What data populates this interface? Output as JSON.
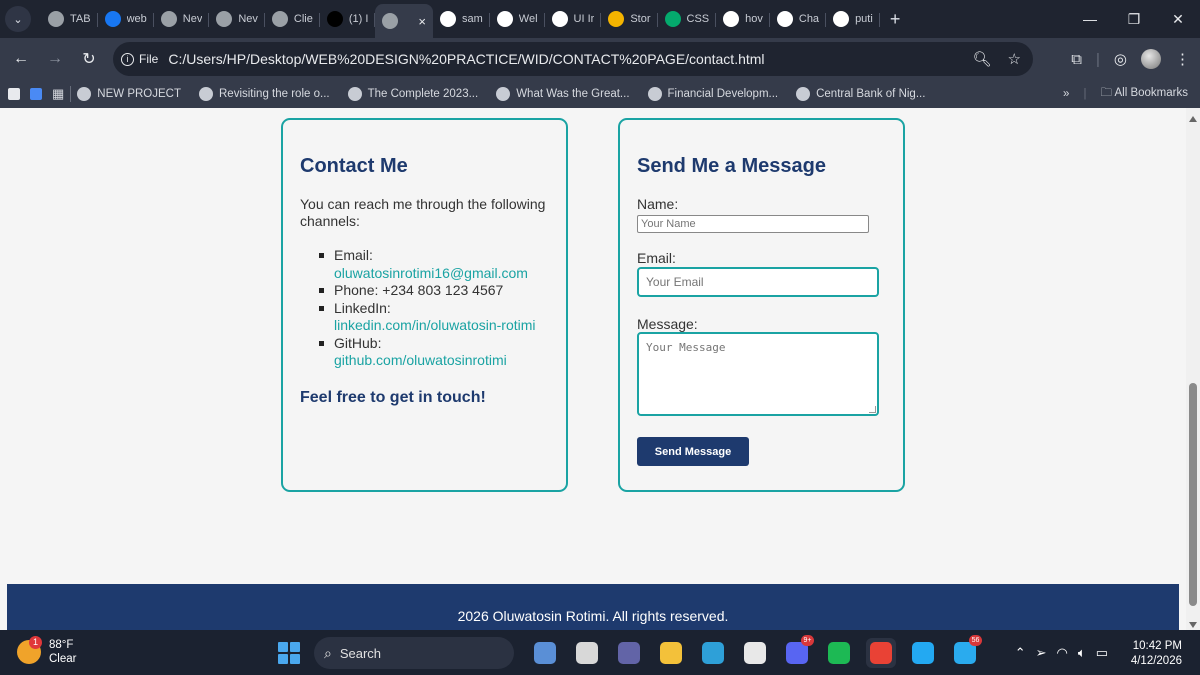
{
  "browser": {
    "tabs": [
      {
        "label": "TAB",
        "icon": "chrome-icon",
        "color": "#9aa0a6"
      },
      {
        "label": "web",
        "icon": "facebook-icon",
        "color": "#1877f2"
      },
      {
        "label": "Nev",
        "icon": "chrome-icon",
        "color": "#9aa0a6"
      },
      {
        "label": "Nev",
        "icon": "chrome-icon",
        "color": "#9aa0a6"
      },
      {
        "label": "Clie",
        "icon": "chrome-icon",
        "color": "#9aa0a6"
      },
      {
        "label": "(1) I",
        "icon": "x-icon",
        "color": "#000000"
      },
      {
        "label": "",
        "icon": "chrome-icon",
        "color": "#9aa0a6",
        "active": true
      },
      {
        "label": "sam",
        "icon": "google-icon",
        "color": "#ffffff"
      },
      {
        "label": "Wel",
        "icon": "openai-icon",
        "color": "#ffffff"
      },
      {
        "label": "UI Ir",
        "icon": "openai-icon",
        "color": "#ffffff"
      },
      {
        "label": "Stor",
        "icon": "google-drive-icon",
        "color": "#f4b400"
      },
      {
        "label": "CSS",
        "icon": "w3schools-icon",
        "color": "#04aa6d"
      },
      {
        "label": "hov",
        "icon": "google-icon",
        "color": "#ffffff"
      },
      {
        "label": "Cha",
        "icon": "google-icon",
        "color": "#ffffff"
      },
      {
        "label": "puti",
        "icon": "google-icon",
        "color": "#ffffff"
      }
    ],
    "active_tab_close": "×",
    "new_tab": "+",
    "address": {
      "scheme_chip": "File",
      "url": "C:/Users/HP/Desktop/WEB%20DESIGN%20PRACTICE/WID/CONTACT%20PAGE/contact.html"
    },
    "bookmarks": [
      {
        "label": "NEW PROJECT"
      },
      {
        "label": "Revisiting the role o..."
      },
      {
        "label": "The Complete 2023..."
      },
      {
        "label": "What Was the Great..."
      },
      {
        "label": "Financial Developm..."
      },
      {
        "label": "Central Bank of Nig..."
      }
    ],
    "bookmarks_overflow": "»",
    "all_bookmarks": "All Bookmarks"
  },
  "page": {
    "contact_card": {
      "title": "Contact Me",
      "intro": "You can reach me through the following channels:",
      "items": [
        {
          "label": "Email:",
          "value": "oluwatosinrotimi16@gmail.com",
          "link": true
        },
        {
          "label": "Phone: +234 803 123 4567",
          "value": "",
          "link": false
        },
        {
          "label": "LinkedIn:",
          "value": "linkedin.com/in/oluwatosin-rotimi",
          "link": true
        },
        {
          "label": "GitHub:",
          "value": "github.com/oluwatosinrotimi",
          "link": true
        }
      ],
      "cta": "Feel free to get in touch!"
    },
    "message_form": {
      "title": "Send Me a Message",
      "name_label": "Name:",
      "name_placeholder": "Your Name",
      "email_label": "Email:",
      "email_placeholder": "Your Email",
      "message_label": "Message:",
      "message_placeholder": "Your Message",
      "submit_label": "Send Message"
    },
    "footer": "2026 Oluwatosin Rotimi. All rights reserved."
  },
  "taskbar": {
    "weather": {
      "temp": "88°F",
      "condition": "Clear",
      "notification_count": "1"
    },
    "search_label": "Search",
    "apps": [
      {
        "icon": "widgets-icon",
        "color": "#5a8fd6"
      },
      {
        "icon": "file-explorer-alt-icon",
        "color": "#d8d8d8"
      },
      {
        "icon": "meet-icon",
        "color": "#6264a7"
      },
      {
        "icon": "file-explorer-icon",
        "color": "#f3c13a"
      },
      {
        "icon": "edge-icon",
        "color": "#2ea0d8"
      },
      {
        "icon": "store-icon",
        "color": "#e8e8e8"
      },
      {
        "icon": "discord-icon",
        "color": "#5865f2",
        "badge": "9+"
      },
      {
        "icon": "spotify-icon",
        "color": "#1db954"
      },
      {
        "icon": "chrome-icon",
        "color": "#e94235",
        "active": true
      },
      {
        "icon": "vscode-icon",
        "color": "#23a9f2"
      },
      {
        "icon": "telegram-icon",
        "color": "#2aabee",
        "badge": "56"
      }
    ],
    "clock_time": "10:42 PM",
    "clock_date": "4/12/2026"
  },
  "colors": {
    "navy": "#1e3a6e",
    "teal": "#1aa3a3",
    "page_bg": "#f5f5f5"
  }
}
